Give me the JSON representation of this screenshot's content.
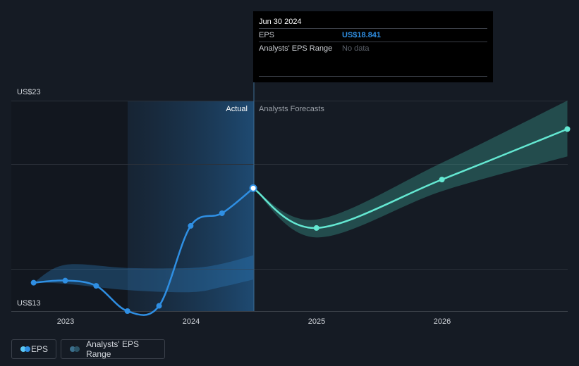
{
  "chart_data": {
    "type": "line",
    "y_axis": {
      "min": 13,
      "max": 23,
      "top_label": "US$23",
      "bottom_label": "US$13",
      "gridline_values": [
        23,
        20,
        15,
        13
      ]
    },
    "x_axis": {
      "tick_labels": [
        "2023",
        "2024",
        "2025",
        "2026"
      ]
    },
    "section_labels": {
      "actual": "Actual",
      "forecast": "Analysts Forecasts"
    },
    "series": [
      {
        "name": "EPS",
        "color": "#2f8fe3",
        "points": [
          {
            "x": "2022-09-30",
            "y": 14.35
          },
          {
            "x": "2022-12-31",
            "y": 14.45
          },
          {
            "x": "2023-03-31",
            "y": 14.2
          },
          {
            "x": "2023-06-30",
            "y": 13.0
          },
          {
            "x": "2023-09-30",
            "y": 13.25
          },
          {
            "x": "2023-12-31",
            "y": 17.05
          },
          {
            "x": "2024-03-31",
            "y": 17.65
          },
          {
            "x": "2024-06-30",
            "y": 18.841
          }
        ]
      },
      {
        "name": "EPS forecast",
        "color": "#64e8d2",
        "points": [
          {
            "x": "2024-06-30",
            "y": 18.841
          },
          {
            "x": "2024-12-31",
            "y": 16.95
          },
          {
            "x": "2025-12-31",
            "y": 19.25
          },
          {
            "x": "2026-12-31",
            "y": 21.65
          }
        ]
      }
    ],
    "historical_range": {
      "name": "Analysts' EPS Range",
      "x": [
        "2022-09-30",
        "2022-12-31",
        "2023-06-30",
        "2023-12-31",
        "2024-03-31",
        "2024-06-30"
      ],
      "high": [
        14.35,
        15.2,
        15.05,
        15.05,
        15.25,
        15.65
      ],
      "low": [
        14.35,
        14.3,
        14.0,
        13.9,
        14.15,
        14.5
      ]
    },
    "forecast_range": {
      "x": [
        "2024-06-30",
        "2024-12-31",
        "2025-12-31",
        "2026-12-31"
      ],
      "high": [
        18.841,
        17.35,
        20.05,
        23.0
      ],
      "low": [
        18.841,
        16.5,
        18.7,
        20.35
      ]
    },
    "highlight_date": "2024-06-30"
  },
  "tooltip": {
    "date": "Jun 30 2024",
    "rows": [
      {
        "key": "EPS",
        "value": "US$18.841"
      },
      {
        "key": "Analysts' EPS Range",
        "value": "No data"
      }
    ]
  },
  "legend": [
    {
      "label": "EPS",
      "colors": [
        "#5cc8f5",
        "#2f8fe3"
      ]
    },
    {
      "label": "Analysts' EPS Range",
      "colors": [
        "#3b6f8c",
        "#2b5366"
      ]
    }
  ]
}
